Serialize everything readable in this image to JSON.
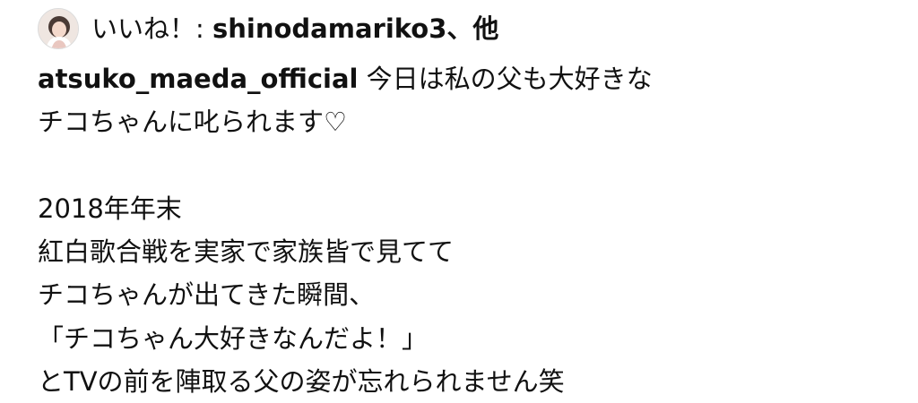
{
  "likes": {
    "prefix": "いいね！: ",
    "user": "shinodamariko3",
    "separator": "、",
    "others": "他"
  },
  "caption": {
    "username": "atsuko_maeda_official",
    "first_line_text": " 今日は私の父も大好きな",
    "lines": [
      "チコちゃんに叱られます♡",
      "",
      "2018年年末",
      "紅白歌合戦を実家で家族皆で見てて",
      "チコちゃんが出てきた瞬間、",
      "「チコちゃん大好きなんだよ！」",
      "とTVの前を陣取る父の姿が忘れられません笑"
    ]
  },
  "icons": {
    "avatar": "profile-avatar"
  }
}
